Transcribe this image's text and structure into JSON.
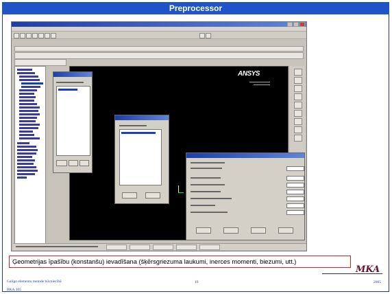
{
  "slide": {
    "title": "Preprocessor",
    "caption": "Ģeometrijas īpašību (konstanšu) ievadīšana (šķērsgriezuma laukumi, inerces momenti, biezumi, utt.)",
    "footer_left_line1": "Galīgo elementu metode būvniecībā",
    "footer_left_line2": "BKA 305",
    "page_number": "19",
    "year": "2005",
    "logo_text": "MKA"
  },
  "screenshot": {
    "viewport_logo": "ANSYS",
    "colors": {
      "title_bar": "#1f54c8",
      "window_title": "#1c3fa8",
      "viewport_bg": "#000000",
      "dialog_bg": "#d4d0c8",
      "caption_border": "#d02020"
    }
  }
}
